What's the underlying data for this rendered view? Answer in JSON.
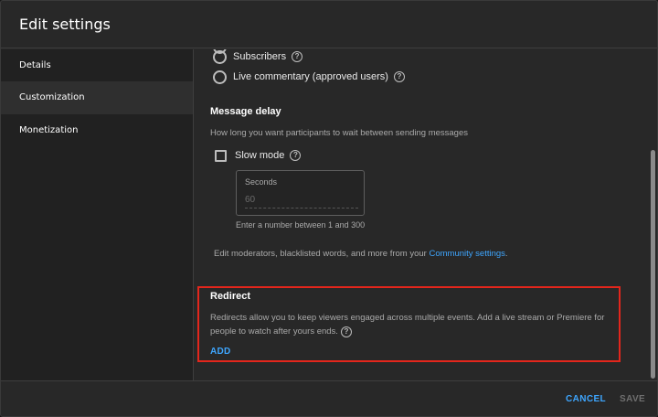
{
  "dialog": {
    "title": "Edit settings"
  },
  "sidebar": {
    "items": [
      {
        "label": "Details"
      },
      {
        "label": "Customization"
      },
      {
        "label": "Monetization"
      }
    ]
  },
  "participants": {
    "options": [
      {
        "label": "Subscribers"
      },
      {
        "label": "Live commentary (approved users)"
      }
    ]
  },
  "message_delay": {
    "title": "Message delay",
    "description": "How long you want participants to wait between sending messages",
    "slow_mode_label": "Slow mode",
    "seconds_label": "Seconds",
    "seconds_placeholder": "60",
    "hint": "Enter a number between 1 and 300"
  },
  "community": {
    "text": "Edit moderators, blacklisted words, and more from your ",
    "link": "Community settings",
    "suffix": "."
  },
  "redirect": {
    "title": "Redirect",
    "description_line1": "Redirects allow you to keep viewers engaged across multiple events. Add a live stream or Premiere for",
    "description_line2": "people to watch after yours ends.",
    "add_label": "ADD"
  },
  "footer": {
    "cancel_label": "CANCEL",
    "save_label": "SAVE"
  },
  "colors": {
    "accent": "#3ea6ff",
    "highlight_border": "#e3261c",
    "background": "#282828"
  },
  "icons": {
    "help": "question-circle-icon"
  }
}
